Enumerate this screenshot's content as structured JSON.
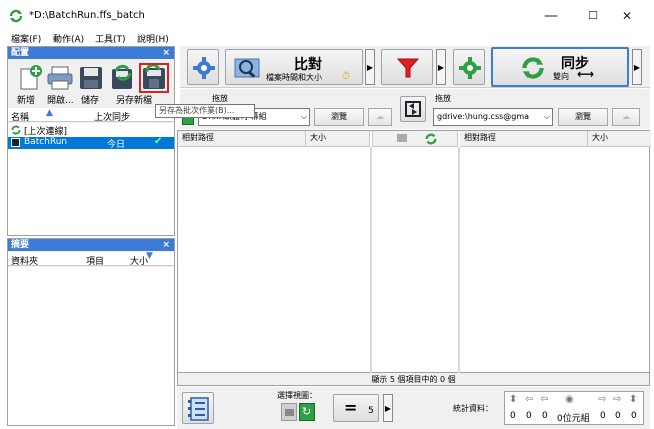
{
  "window": {
    "title": "*D:\\BatchRun.ffs_batch",
    "controls": {
      "minimize": "—",
      "maximize": "☐",
      "close": "✕"
    }
  },
  "menu": [
    "檔案(F)",
    "動作(A)",
    "工具(T)",
    "說明(H)"
  ],
  "config_panel": {
    "title": "配置",
    "close": "×",
    "buttons": [
      "新增",
      "開啟...",
      "儲存",
      "另存新檔",
      "另存為批次作業..."
    ],
    "tooltip": "另存為批次作業(B)...",
    "columns": [
      "名稱",
      "上次同步"
    ],
    "rows": [
      {
        "name": "[上次連線]",
        "last_sync": ""
      },
      {
        "name": "BatchRun",
        "last_sync": "今日"
      }
    ]
  },
  "summary_panel": {
    "title": "摘要",
    "close": "×",
    "columns": [
      "資料夾",
      "項目",
      "大小"
    ]
  },
  "toolbar": {
    "compare_title": "比對",
    "compare_sub": "檔案時間和大小",
    "sync_title": "同步",
    "sync_sub": "雙向"
  },
  "left_folder": {
    "label": "拖放",
    "path": "D:\\...\\軟體\\字幕組",
    "browse": "瀏覽"
  },
  "right_folder": {
    "label": "拖放",
    "path": "gdrive:\\hung.css@gma",
    "browse": "瀏覽"
  },
  "grid": {
    "left_cols": [
      "相對路徑",
      "大小"
    ],
    "right_cols": [
      "相對路徑",
      "大小"
    ],
    "status": "顯示 5 個項目中的 0 個"
  },
  "bottom": {
    "view_label": "選擇視圖：",
    "equal_count": "5",
    "stats_label": "統計資料：",
    "stats": [
      "0",
      "0",
      "0",
      "0位元組",
      "0",
      "0",
      "0"
    ]
  },
  "colors": {
    "accent": "#3c7bd6",
    "selected": "#0078d7",
    "green": "#2ea043",
    "red": "#e02020"
  }
}
